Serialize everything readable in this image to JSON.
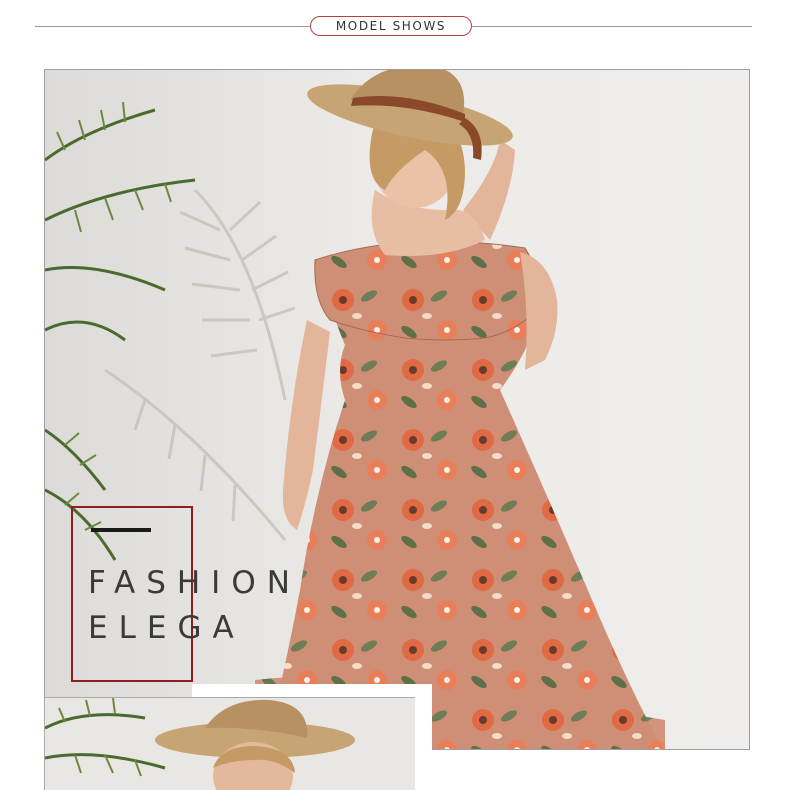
{
  "header": {
    "title": "MODEL SHOWS"
  },
  "overlay": {
    "line1": "FASHION",
    "line2": "ELEGA"
  },
  "colors": {
    "accent_red": "#8e1e1e",
    "pill_border": "#b0443d",
    "dress": "#cf8f77",
    "hat": "#c7a473"
  },
  "images": {
    "main": "model-photo-straw-hat-floral-dress",
    "second": "model-photo-straw-hat-closeup"
  }
}
